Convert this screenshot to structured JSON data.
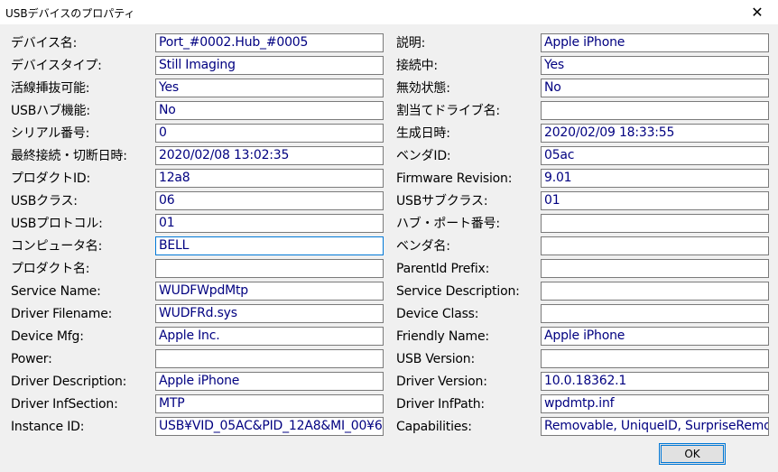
{
  "window": {
    "title": "USBデバイスのプロパティ",
    "close_glyph": "✕"
  },
  "left": [
    {
      "label": "デバイス名:",
      "value": "Port_#0002.Hub_#0005"
    },
    {
      "label": "デバイスタイプ:",
      "value": "Still Imaging"
    },
    {
      "label": "活線挿抜可能:",
      "value": "Yes"
    },
    {
      "label": "USBハブ機能:",
      "value": "No"
    },
    {
      "label": "シリアル番号:",
      "value": "0"
    },
    {
      "label": "最終接続・切断日時:",
      "value": "2020/02/08 13:02:35"
    },
    {
      "label": "プロダクトID:",
      "value": "12a8"
    },
    {
      "label": "USBクラス:",
      "value": "06"
    },
    {
      "label": "USBプロトコル:",
      "value": "01"
    },
    {
      "label": "コンピュータ名:",
      "value": "BELL"
    },
    {
      "label": "プロダクト名:",
      "value": ""
    },
    {
      "label": "Service Name:",
      "value": "WUDFWpdMtp"
    },
    {
      "label": "Driver Filename:",
      "value": "WUDFRd.sys"
    },
    {
      "label": "Device Mfg:",
      "value": "Apple Inc."
    },
    {
      "label": "Power:",
      "value": ""
    },
    {
      "label": "Driver Description:",
      "value": "Apple iPhone"
    },
    {
      "label": "Driver InfSection:",
      "value": "MTP"
    },
    {
      "label": "Instance ID:",
      "value": "USB¥VID_05AC&PID_12A8&MI_00¥6"
    }
  ],
  "right": [
    {
      "label": "説明:",
      "value": "Apple iPhone"
    },
    {
      "label": "接続中:",
      "value": "Yes"
    },
    {
      "label": "無効状態:",
      "value": "No"
    },
    {
      "label": "割当てドライブ名:",
      "value": ""
    },
    {
      "label": "生成日時:",
      "value": "2020/02/09 18:33:55"
    },
    {
      "label": "ベンダID:",
      "value": "05ac"
    },
    {
      "label": "Firmware Revision:",
      "value": "9.01"
    },
    {
      "label": "USBサブクラス:",
      "value": "01"
    },
    {
      "label": "ハブ・ポート番号:",
      "value": ""
    },
    {
      "label": "ベンダ名:",
      "value": ""
    },
    {
      "label": "ParentId Prefix:",
      "value": ""
    },
    {
      "label": "Service Description:",
      "value": ""
    },
    {
      "label": "Device Class:",
      "value": ""
    },
    {
      "label": "Friendly Name:",
      "value": "Apple iPhone"
    },
    {
      "label": "USB Version:",
      "value": ""
    },
    {
      "label": "Driver Version:",
      "value": "10.0.18362.1"
    },
    {
      "label": "Driver InfPath:",
      "value": "wpdmtp.inf"
    },
    {
      "label": "Capabilities:",
      "value": "Removable, UniqueID, SurpriseRemo"
    }
  ],
  "buttons": {
    "ok": "OK"
  }
}
